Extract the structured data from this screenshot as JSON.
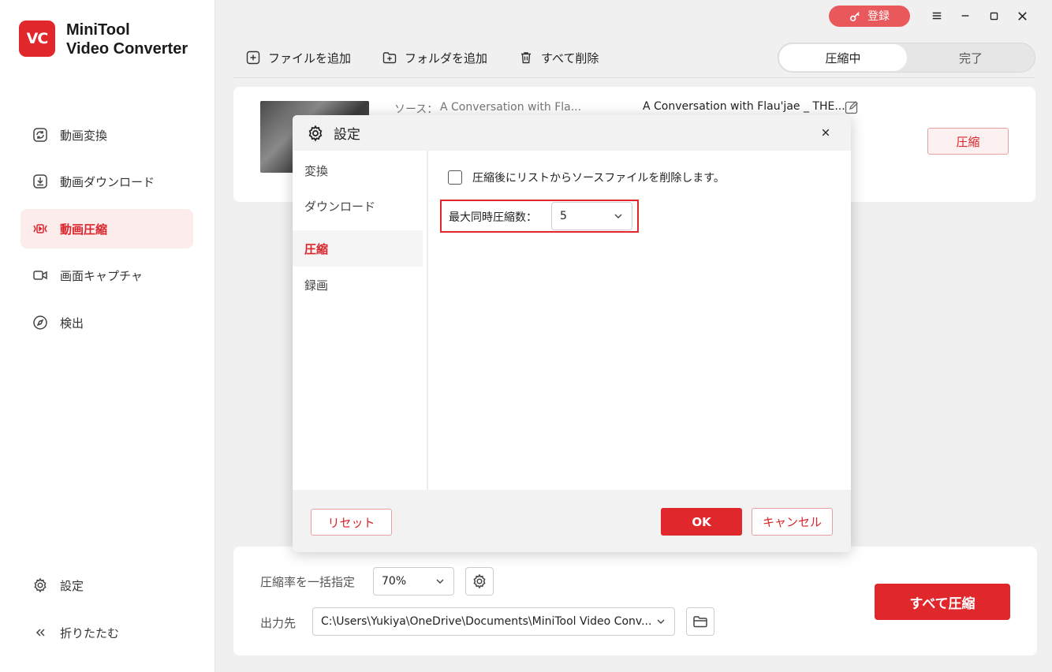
{
  "app": {
    "logo_text": "VC",
    "brand_line1": "MiniTool",
    "brand_line2": "Video Converter"
  },
  "sidebar": {
    "items": [
      {
        "label": "動画変換",
        "icon": "refresh-icon"
      },
      {
        "label": "動画ダウンロード",
        "icon": "download-icon"
      },
      {
        "label": "動画圧縮",
        "icon": "compress-icon",
        "active": true
      },
      {
        "label": "画面キャプチャ",
        "icon": "camera-icon"
      },
      {
        "label": "検出",
        "icon": "compass-icon"
      }
    ],
    "bottom": [
      {
        "label": "設定",
        "icon": "gear-icon"
      },
      {
        "label": "折りたたむ",
        "icon": "collapse-icon"
      }
    ]
  },
  "titlebar": {
    "register_label": "登録"
  },
  "toolbar": {
    "add_file": "ファイルを追加",
    "add_folder": "フォルダを追加",
    "delete_all": "すべて削除"
  },
  "tabs": {
    "compressing": "圧縮中",
    "done": "完了"
  },
  "file": {
    "source_label": "ソース：",
    "source_name": "A Conversation with Fla...",
    "output_name": "A Conversation with Flau'jae _ THE...",
    "compress_button": "圧縮"
  },
  "bottom": {
    "rate_label": "圧縮率を一括指定",
    "rate_value": "70%",
    "output_label": "出力先",
    "output_path": "C:\\Users\\Yukiya\\OneDrive\\Documents\\MiniTool Video Conv...",
    "compress_all": "すべて圧縮"
  },
  "dialog": {
    "title": "設定",
    "tabs": [
      "変換",
      "ダウンロード",
      "圧縮",
      "録画"
    ],
    "active_tab": "圧縮",
    "delete_source_label": "圧縮後にリストからソースファイルを削除します。",
    "max_label": "最大同時圧縮数：",
    "max_value": "5",
    "reset": "リセット",
    "ok": "OK",
    "cancel": "キャンセル"
  },
  "colors": {
    "accent": "#e0272b",
    "accent_light": "#fdecec",
    "register_bg": "#e9585b"
  }
}
